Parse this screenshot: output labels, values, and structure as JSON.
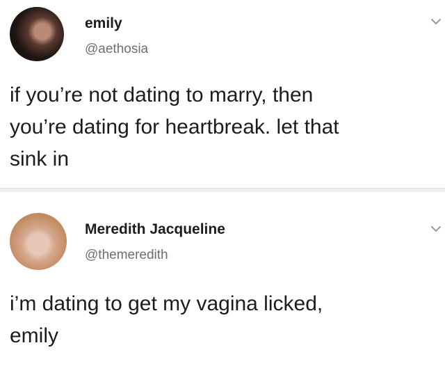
{
  "tweets": [
    {
      "display_name": "emily",
      "handle": "@aethosia",
      "text": "if you’re not dating to marry, then\nyou’re dating for heartbreak. let that\nsink in",
      "menu_icon": "chevron-down-icon"
    },
    {
      "display_name": "Meredith Jacqueline",
      "handle": "@themeredith",
      "text": "i’m dating to get my vagina licked,\nemily",
      "menu_icon": "chevron-down-icon"
    }
  ],
  "colors": {
    "text": "#1c1c1c",
    "secondary_text": "#6e6e6e",
    "divider": "#ededed"
  }
}
